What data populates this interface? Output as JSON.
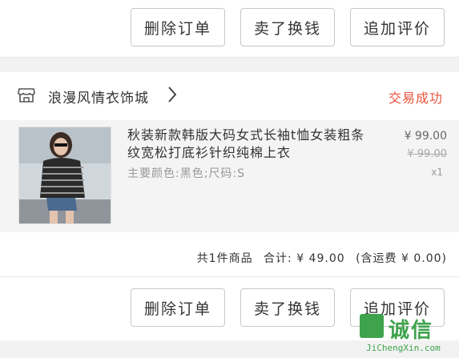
{
  "top_actions": {
    "delete_label": "删除订单",
    "resell_label": "卖了换钱",
    "review_label": "追加评价"
  },
  "store": {
    "icon": "store-icon",
    "name": "浪漫风情衣饰城",
    "status": "交易成功",
    "status_color": "#e8533c"
  },
  "product": {
    "title": "秋装新款韩版大码女式长袖t恤女装粗条纹宽松打底衫针织纯棉上衣",
    "spec": "主要颜色:黑色;尺码:S",
    "price": "¥ 99.00",
    "original_price": "¥ 99.00",
    "quantity": "x1"
  },
  "summary": {
    "count_text": "共1件商品",
    "total_text": "合计: ¥ 49.00",
    "shipping_text": "(含运费 ¥ 0.00)"
  },
  "bottom_actions": {
    "delete_label": "删除订单",
    "resell_label": "卖了换钱",
    "review_label": "追加评价"
  },
  "watermark": {
    "cn": "诚信",
    "en": "JiChengXin.com",
    "color": "#3fa34d"
  }
}
